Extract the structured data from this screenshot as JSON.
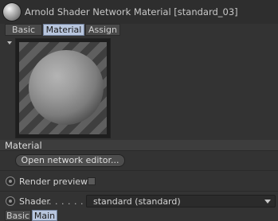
{
  "window": {
    "title": "Arnold Shader Network Material [standard_03]"
  },
  "tabs": [
    {
      "label": "Basic",
      "active": false
    },
    {
      "label": "Material",
      "active": true
    },
    {
      "label": "Assign",
      "active": false
    }
  ],
  "section": {
    "title": "Material"
  },
  "buttons": {
    "open_network_editor": "Open network editor..."
  },
  "render_preview": {
    "label": "Render preview",
    "checked": false
  },
  "shader": {
    "label": "Shader",
    "dots": ". . . . . . . .",
    "selected": "standard (standard)"
  },
  "bottom_tabs": [
    {
      "label": "Basic",
      "active": false
    },
    {
      "label": "Main",
      "active": true
    }
  ],
  "icons": {
    "material_ball": "material-sphere-icon",
    "expand": "triangle-down-icon",
    "radio": "radio-icon",
    "dropdown": "chevron-down-icon"
  },
  "colors": {
    "background": "#333333",
    "active_tab": "#b8c6de",
    "dropdown_bg": "#2b2b2b"
  }
}
